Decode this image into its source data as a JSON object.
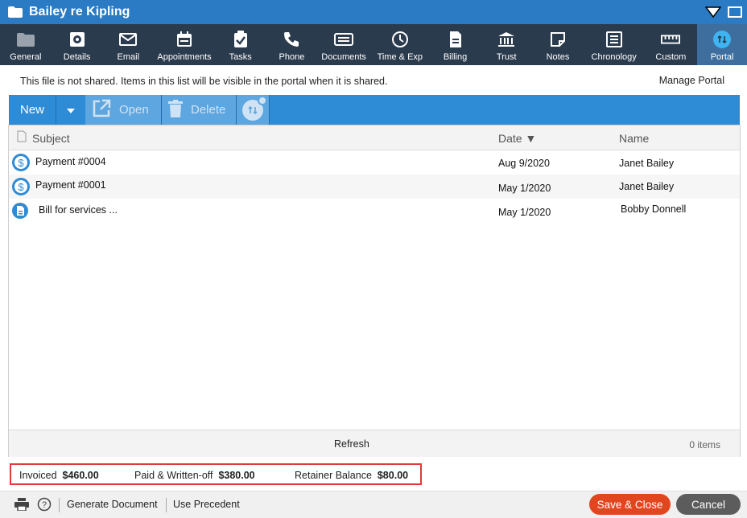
{
  "window": {
    "title": "Bailey re Kipling"
  },
  "nav": {
    "tabs": [
      {
        "label": "General",
        "icon": "folder-icon"
      },
      {
        "label": "Details",
        "icon": "gear-doc-icon"
      },
      {
        "label": "Email",
        "icon": "envelope-icon"
      },
      {
        "label": "Appointments",
        "icon": "calendar-icon"
      },
      {
        "label": "Tasks",
        "icon": "clipboard-check-icon"
      },
      {
        "label": "Phone",
        "icon": "phone-icon"
      },
      {
        "label": "Documents",
        "icon": "documents-icon"
      },
      {
        "label": "Time & Exp",
        "icon": "clock-icon"
      },
      {
        "label": "Billing",
        "icon": "bill-icon"
      },
      {
        "label": "Trust",
        "icon": "bank-icon"
      },
      {
        "label": "Notes",
        "icon": "note-icon"
      },
      {
        "label": "Chronology",
        "icon": "list-icon"
      },
      {
        "label": "Custom",
        "icon": "ruler-icon"
      },
      {
        "label": "Portal",
        "icon": "portal-sync-icon"
      }
    ],
    "active": "Portal"
  },
  "info": {
    "message": "This file is not shared. Items in this list will be visible in the portal when it is shared.",
    "manage_link": "Manage Portal"
  },
  "toolbar": {
    "new_label": "New",
    "open_label": "Open",
    "delete_label": "Delete"
  },
  "list": {
    "columns": {
      "subject": "Subject",
      "date": "Date ▼",
      "name": "Name"
    },
    "rows": [
      {
        "subject": "Payment #0004",
        "date": "Aug 9/2020",
        "name": "Janet Bailey",
        "icon": "payment-icon"
      },
      {
        "subject": "Payment #0001",
        "date": "May 1/2020",
        "name": "Janet Bailey",
        "icon": "payment-icon"
      },
      {
        "subject": "Bill for services ...",
        "date": "May 1/2020",
        "name": "Bobby Donnell",
        "icon": "bill-doc-icon"
      }
    ],
    "refresh_label": "Refresh",
    "count_label": "0 items"
  },
  "totals": {
    "invoiced_label": "Invoiced",
    "invoiced_value": "$460.00",
    "paid_label": "Paid  & Written-off",
    "paid_value": "$380.00",
    "retainer_label": "Retainer Balance",
    "retainer_value": "$80.00"
  },
  "footer": {
    "generate_label": "Generate Document",
    "precedent_label": "Use Precedent",
    "save_label": "Save & Close",
    "cancel_label": "Cancel"
  },
  "colors": {
    "titlebar": "#2a7bc4",
    "nav": "#2b3b4e",
    "toolbar": "#2e8bd6",
    "save": "#e2461f",
    "cancel": "#5c5c5c",
    "highlight_border": "#e03a3a"
  }
}
